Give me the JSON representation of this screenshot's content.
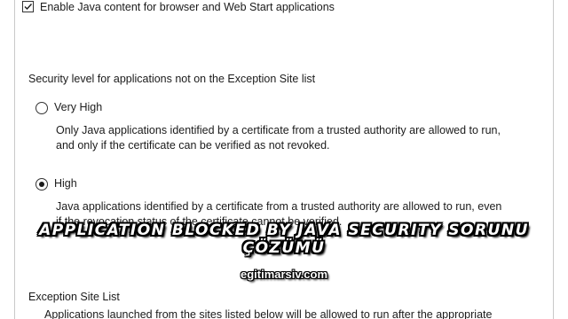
{
  "java_settings": {
    "enable_checkbox_label": "Enable Java content for browser and Web Start applications",
    "enable_checked": true,
    "security_level_label": "Security level for applications not on the Exception Site list",
    "options": [
      {
        "label": "Very High",
        "selected": false,
        "description_line1": "Only Java applications identified by a certificate from a trusted authority are allowed to run,",
        "description_line2": "and only if the certificate can be verified as not revoked."
      },
      {
        "label": "High",
        "selected": true,
        "description_line1": "Java applications identified by a certificate from a trusted authority are allowed to run, even",
        "description_line2": "if the revocation status of the certificate cannot be verified."
      }
    ],
    "exception_site_list_label": "Exception Site List",
    "exception_site_list_text": "Applications launched from the sites listed below will be allowed to run after the appropriate"
  },
  "overlay": {
    "title_line1": "APPLICATION BLOCKED BY JAVA SECURITY SORUNU",
    "title_line2": "ÇÖZÜMÜ",
    "site": "egitimarsiv.com"
  },
  "colors": {
    "text": "#1b1b1b",
    "border": "#c9c9c9",
    "overlay_text": "#ffffff",
    "overlay_outline": "#000000"
  }
}
